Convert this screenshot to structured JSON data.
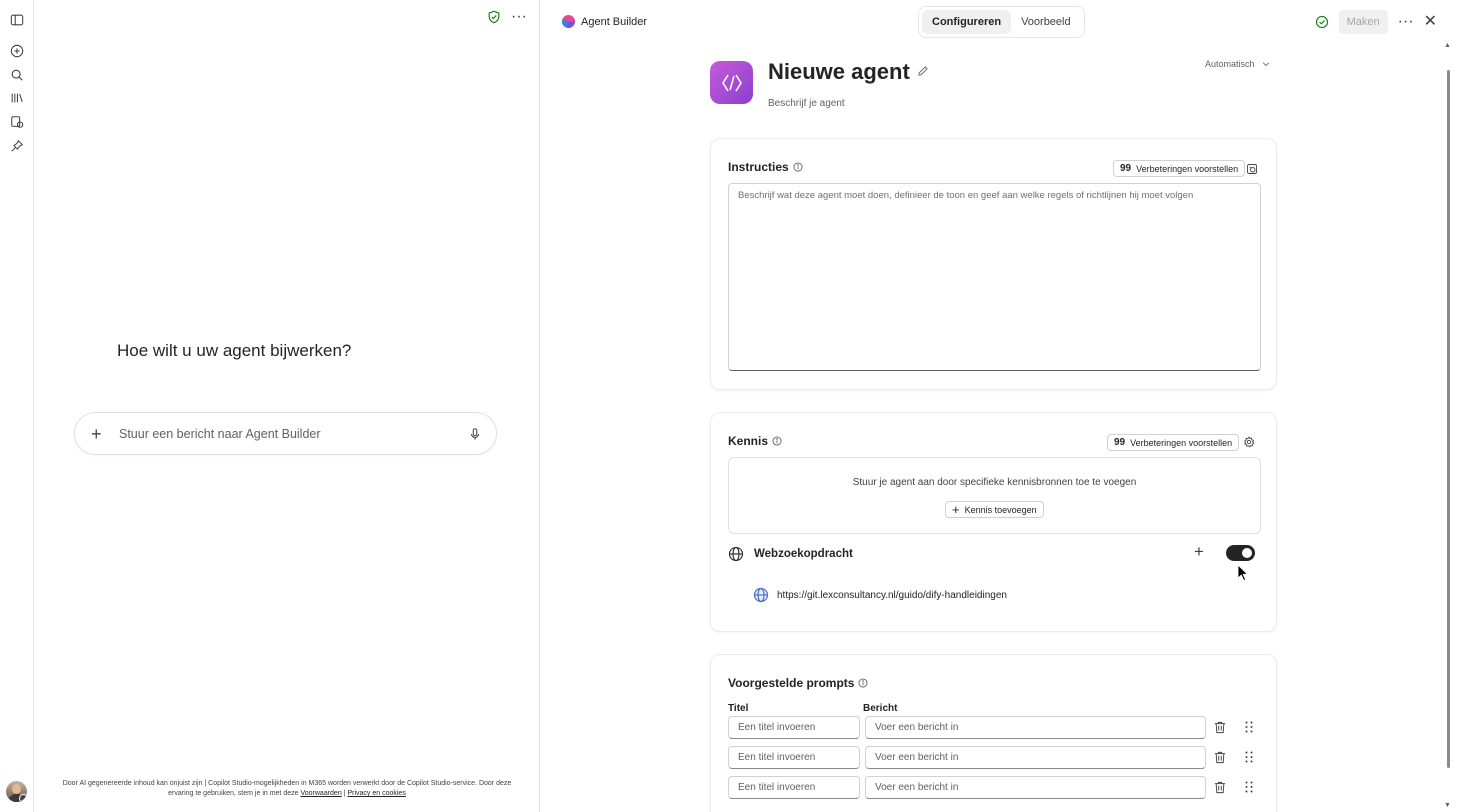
{
  "rail": {
    "items": [
      "sidebar-toggle",
      "new-chat",
      "search",
      "library",
      "agents",
      "pin"
    ]
  },
  "chat": {
    "question": "Hoe wilt u uw agent bijwerken?",
    "input_placeholder": "Stuur een bericht naar Agent Builder",
    "disclaimer_text": "Door AI gegenereerde inhoud kan onjuist zijn | Copilot Studio-mogelijkheden in M365 worden verwerkt door de Copilot Studio-service. Door deze ervaring te gebruiken, stem je in met deze",
    "terms_link": "Voorwaarden",
    "separator": "|",
    "privacy_link": "Privacy en cookies"
  },
  "topbar": {
    "app_title": "Agent Builder",
    "tabs": [
      {
        "label": "Configureren",
        "active": true
      },
      {
        "label": "Voorbeeld",
        "active": false
      }
    ],
    "make_label": "Maken"
  },
  "agent": {
    "name": "Nieuwe agent",
    "description": "Beschrijf je agent",
    "model": "Automatisch"
  },
  "instructions": {
    "title": "Instructies",
    "suggest_label": "Verbeteringen voorstellen",
    "placeholder": "Beschrijf wat deze agent moet doen, definieer de toon en geef aan welke regels of richtlijnen hij moet volgen"
  },
  "knowledge": {
    "title": "Kennis",
    "suggest_label": "Verbeteringen voorstellen",
    "empty_message": "Stuur je agent aan door specifieke kennisbronnen toe te voegen",
    "add_label": "Kennis toevoegen",
    "web_search_label": "Webzoekopdracht",
    "web_search_enabled": true,
    "url": "https://git.lexconsultancy.nl/guido/dify-handleidingen"
  },
  "prompts": {
    "title": "Voorgestelde prompts",
    "col_title": "Titel",
    "col_message": "Bericht",
    "title_placeholder": "Een titel invoeren",
    "message_placeholder": "Voer een bericht in"
  },
  "colors": {
    "accent_purple": "#8a3fd0",
    "success_green": "#107c10",
    "toggle_on": "#242424"
  }
}
